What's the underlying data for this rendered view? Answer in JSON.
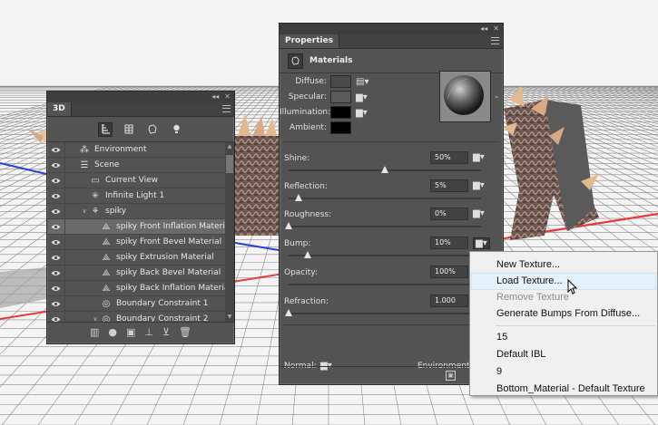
{
  "panel_3d": {
    "tab": "3D",
    "toolbar_icons": [
      "whole-scene-icon",
      "meshes-icon",
      "materials-icon",
      "lights-icon"
    ],
    "layers": [
      {
        "label": "Environment",
        "icon": "environment-icon",
        "indent": 0
      },
      {
        "label": "Scene",
        "icon": "scene-icon",
        "indent": 0
      },
      {
        "label": "Current View",
        "icon": "camera-icon",
        "indent": 1
      },
      {
        "label": "Infinite Light 1",
        "icon": "light-icon",
        "indent": 1
      },
      {
        "label": "spiky",
        "icon": "mesh-icon",
        "indent": 1
      },
      {
        "label": "spiky Front Inflation Material",
        "icon": "material-icon",
        "indent": 2
      },
      {
        "label": "spiky Front Bevel Material",
        "icon": "material-icon",
        "indent": 2
      },
      {
        "label": "spiky Extrusion Material",
        "icon": "material-icon",
        "indent": 2
      },
      {
        "label": "spiky Back Bevel Material",
        "icon": "material-icon",
        "indent": 2
      },
      {
        "label": "spiky Back Inflation Material",
        "icon": "material-icon",
        "indent": 2
      },
      {
        "label": "Boundary Constraint 1",
        "icon": "constraint-icon",
        "indent": 2
      },
      {
        "label": "Boundary Constraint 2",
        "icon": "constraint-icon",
        "indent": 2
      }
    ],
    "bottom_icons": [
      "delete-scene-icon",
      "add-light-icon",
      "render-icon",
      "export-icon",
      "move-icon",
      "trash-icon"
    ]
  },
  "properties": {
    "tab": "Properties",
    "section_title": "Materials",
    "colors": [
      {
        "label": "Diffuse:",
        "color": "#4a4a4a"
      },
      {
        "label": "Specular:",
        "color": "#5a5a5a"
      },
      {
        "label": "Illumination:",
        "color": "#000000"
      },
      {
        "label": "Ambient:",
        "color": "#000000"
      }
    ],
    "sliders": [
      {
        "label": "Shine:",
        "value": "50%",
        "fraction": 0.5
      },
      {
        "label": "Reflection:",
        "value": "5%",
        "fraction": 0.05
      },
      {
        "label": "Roughness:",
        "value": "0%",
        "fraction": 0.0
      },
      {
        "label": "Bump:",
        "value": "10%",
        "fraction": 0.1
      },
      {
        "label": "Opacity:",
        "value": "100%",
        "fraction": 1.0
      },
      {
        "label": "Refraction:",
        "value": "1.000",
        "fraction": 0.0
      }
    ],
    "normal_label": "Normal:",
    "environment_label": "Environment:"
  },
  "context_menu": {
    "items": [
      {
        "label": "New Texture...",
        "state": "normal"
      },
      {
        "label": "Load Texture...",
        "state": "hover"
      },
      {
        "label": "Remove Texture",
        "state": "disabled"
      },
      {
        "label": "Generate Bumps From Diffuse...",
        "state": "normal"
      },
      {
        "label": "15",
        "state": "normal"
      },
      {
        "label": "Default IBL",
        "state": "normal"
      },
      {
        "label": "9",
        "state": "normal"
      },
      {
        "label": "Bottom_Material - Default Texture",
        "state": "normal"
      }
    ]
  }
}
